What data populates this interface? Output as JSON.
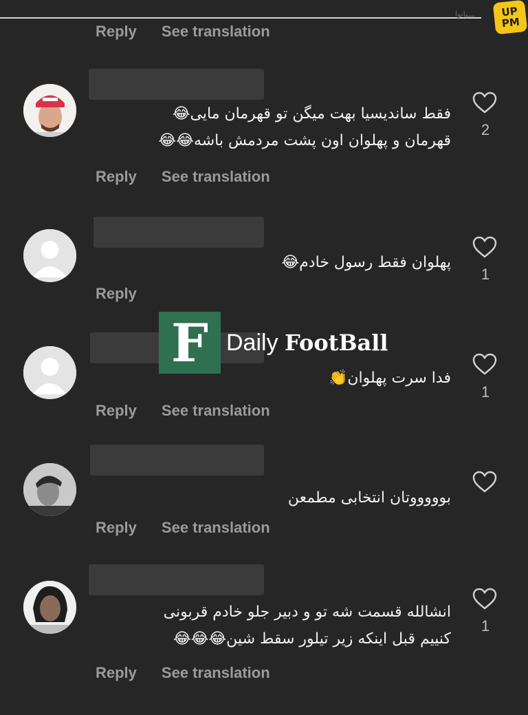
{
  "header": {
    "faint_text": "ـــپانوا"
  },
  "corner_logo": {
    "line1": "UP",
    "line2": "PM",
    "color": "#f5c518"
  },
  "labels": {
    "reply": "Reply",
    "see_translation": "See translation"
  },
  "watermark": {
    "box_letter": "F",
    "text_regular": "Daily ",
    "text_bold": "FootBall",
    "box_color": "#2f7050"
  },
  "comments": [
    {
      "text": "فقط ساندیسیا بهت میگن تو قهرمان مایی😂\nقهرمان و پهلوان اون پشت مردمش باشه😂😂",
      "likes": "2"
    },
    {
      "text": "پهلوان فقط رسول خادم😂",
      "likes": "1"
    },
    {
      "text": "فدا سرت پهلوان👏",
      "likes": "1"
    },
    {
      "text": "بوووووتان انتخابی مطمعن",
      "likes": ""
    },
    {
      "text": "انشالله قسمت شه تو و دبیر جلو خادم قربونی\nکنییم قبل اینکه زیر تیلور سقط شین😂😂😂",
      "likes": "1"
    }
  ],
  "colors": {
    "background": "#262626",
    "text": "#f2f2f2",
    "secondary": "#9b9b9b"
  }
}
